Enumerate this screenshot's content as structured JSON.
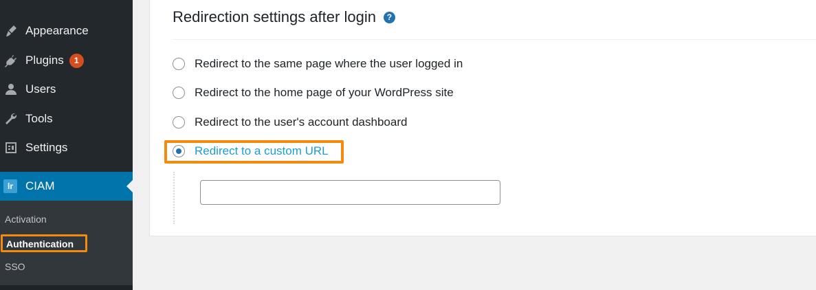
{
  "sidebar": {
    "items": [
      {
        "label": "Appearance",
        "icon": "paintbrush-icon"
      },
      {
        "label": "Plugins",
        "icon": "plugin-icon",
        "badge": "1"
      },
      {
        "label": "Users",
        "icon": "user-icon"
      },
      {
        "label": "Tools",
        "icon": "wrench-icon"
      },
      {
        "label": "Settings",
        "icon": "settings-icon"
      }
    ],
    "active": {
      "label": "CIAM",
      "logo": "lr"
    },
    "submenu": [
      {
        "label": "Activation"
      },
      {
        "label": "Authentication"
      },
      {
        "label": "SSO"
      }
    ]
  },
  "main": {
    "title": "Redirection settings after login",
    "help_glyph": "?",
    "options": [
      {
        "label": "Redirect to the same page where the user logged in",
        "checked": false
      },
      {
        "label": "Redirect to the home page of your WordPress site",
        "checked": false
      },
      {
        "label": "Redirect to the user's account dashboard",
        "checked": false
      },
      {
        "label": "Redirect to a custom URL",
        "checked": true
      }
    ],
    "custom_url_value": ""
  },
  "colors": {
    "sidebar_bg": "#23282d",
    "active_bg": "#0073aa",
    "highlight": "#f18c0f",
    "accent": "#1e9bd7",
    "badge": "#d54e21"
  }
}
